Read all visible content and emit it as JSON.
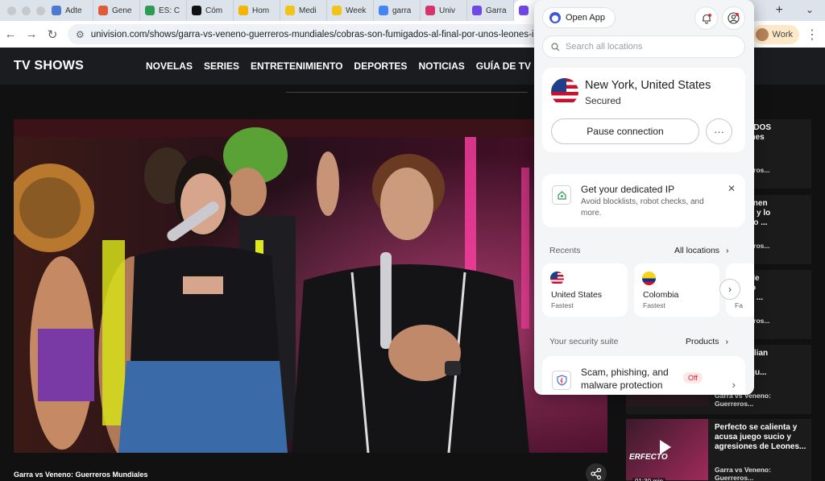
{
  "browser": {
    "tabs": [
      {
        "label": "Adte",
        "color": "#4a7bd0"
      },
      {
        "label": "Gene",
        "color": "#e05a3a"
      },
      {
        "label": "ES: C",
        "color": "#2f9a55"
      },
      {
        "label": "Cóm",
        "color": "#111111"
      },
      {
        "label": "Hom",
        "color": "#f4b400"
      },
      {
        "label": "Medi",
        "color": "#f0c419"
      },
      {
        "label": "Week",
        "color": "#f0c419"
      },
      {
        "label": "garra",
        "color": "#4285f4"
      },
      {
        "label": "Univ",
        "color": "#d6336c"
      },
      {
        "label": "Garra",
        "color": "#7048e8"
      },
      {
        "label": "",
        "color": "#7048e8",
        "active": true
      },
      {
        "label": "",
        "color": "#2f9a55"
      }
    ],
    "url": "univision.com/shows/garra-vs-veneno-guerreros-mundiales/cobras-son-fumigados-al-final-por-unos-leones-indomables",
    "profile_label": "Work"
  },
  "site": {
    "brand": "TV SHOWS",
    "nav": [
      "NOVELAS",
      "SERIES",
      "ENTRETENIMIENTO",
      "DEPORTES",
      "NOTICIAS",
      "GUÍA DE TV"
    ],
    "video_caption": "Garra vs Veneno: Guerreros Mundiales"
  },
  "rail": [
    {
      "title_lines": [
        "n FUMIGADOS",
        "unos Leones",
        "s"
      ],
      "source": "eno: Guerreros..."
    },
    {
      "title_lines": [
        "y Nano tienen",
        "CANTADO y lo",
        "con un reto ..."
      ],
      "source": "eno: Guerreros..."
    },
    {
      "title_lines": [
        "ó el traje de",
        "id y por no",
        "da ventaja ..."
      ],
      "source": "eno: Guerreros..."
    },
    {
      "title_lines": [
        "smayan Lilian",
        "or el",
        "esfuerzo qu..."
      ],
      "source": "Garra vs Veneno: Guerreros..."
    },
    {
      "title_lines": [
        "Perfecto se calienta y",
        "acusa juego sucio y",
        "agresiones de Leones..."
      ],
      "source": "Garra vs Veneno: Guerreros...",
      "thumb_text": "ERFECTO",
      "duration": "01:30 min"
    }
  ],
  "vpn": {
    "open_app": "Open App",
    "search_placeholder": "Search all locations",
    "location": "New York, United States",
    "status": "Secured",
    "pause": "Pause connection",
    "more": "···",
    "ip_title": "Get your dedicated IP",
    "ip_desc": "Avoid blocklists, robot checks, and more.",
    "recents_label": "Recents",
    "all_locations": "All locations",
    "recents": [
      {
        "name": "United States",
        "sub": "Fastest"
      },
      {
        "name": "Colombia",
        "sub": "Fastest"
      },
      {
        "name": "",
        "sub": "Fa"
      }
    ],
    "suite_label": "Your security suite",
    "products": "Products",
    "feature_title": "Scam, phishing, and malware protection",
    "feature_status": "Off"
  }
}
